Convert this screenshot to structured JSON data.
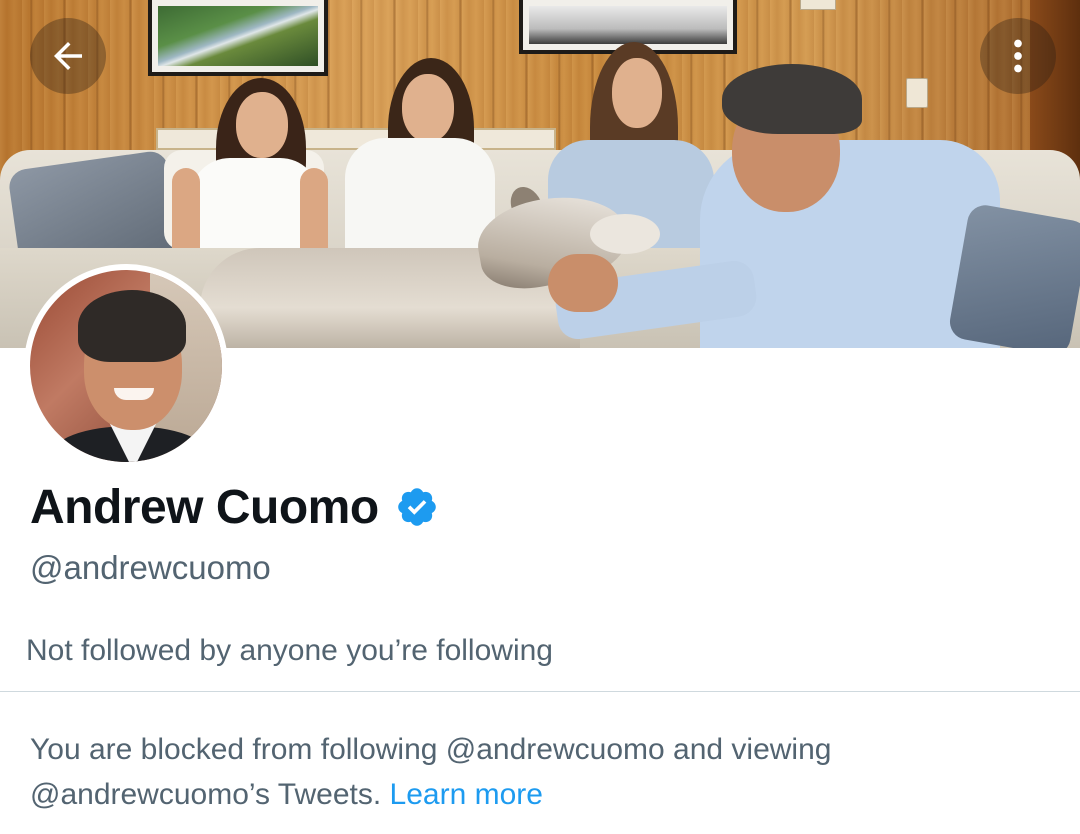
{
  "header": {
    "back_icon": "arrow-left-icon",
    "more_icon": "more-vertical-icon"
  },
  "profile": {
    "display_name": "Andrew Cuomo",
    "handle": "@andrewcuomo",
    "verified_icon": "verified-badge-icon",
    "verified_color": "#1d9bf0",
    "followed_by_text": "Not followed by anyone you’re following"
  },
  "blocked_notice": {
    "message": "You are blocked from following @andrewcuomo and viewing @andrewcuomo’s Tweets.",
    "link_label": "Learn more",
    "link_color": "#1d9bf0"
  }
}
